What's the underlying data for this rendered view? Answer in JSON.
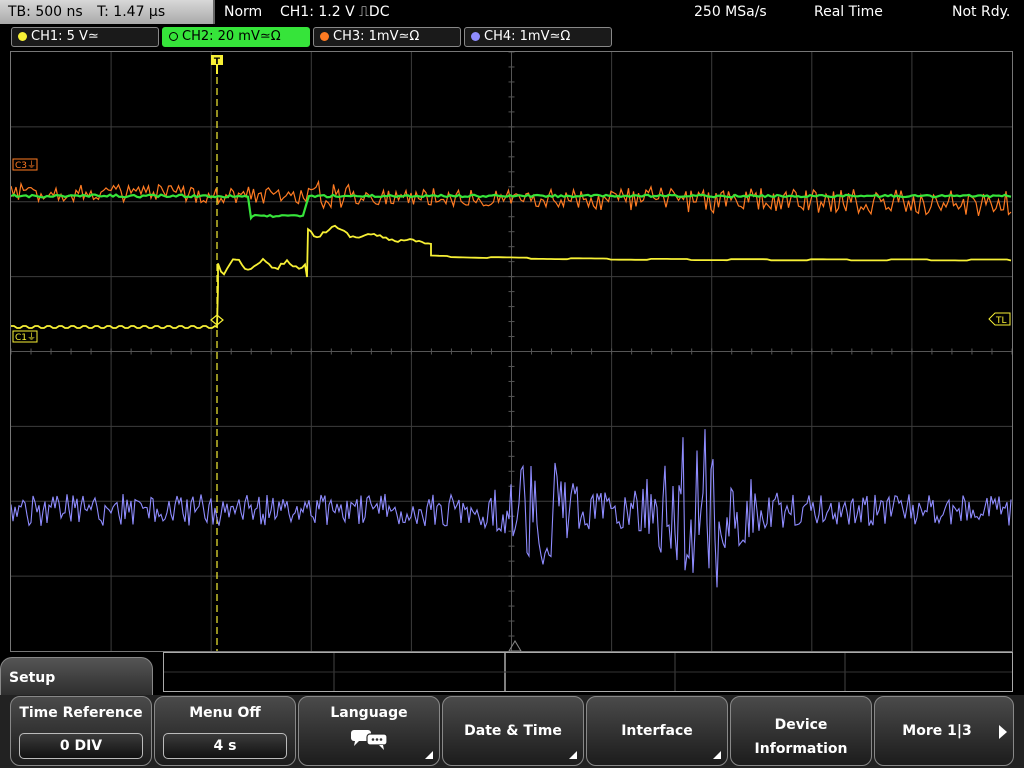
{
  "status": {
    "timebase": "TB: 500 ns",
    "trigger_time": "T: 1.47 µs",
    "mode": "Norm",
    "trigger": "CH1: 1.2 V ⎍DC",
    "sample_rate": "250 MSa/s",
    "acq": "Real Time",
    "state": "Not Rdy."
  },
  "channels": [
    {
      "label": "CH1: 5 V≃",
      "color": "#f7f035"
    },
    {
      "label": "CH2: 20 mV≃Ω",
      "color": "#36e43a"
    },
    {
      "label": "CH3: 1mV≃Ω",
      "color": "#ff7b22"
    },
    {
      "label": "CH4: 1mV≃Ω",
      "color": "#8f8cff"
    }
  ],
  "markers": {
    "c3": "C3⏚",
    "c1": "C1⏚",
    "tl": "TL",
    "trigger": "T"
  },
  "menu": {
    "title": "Setup",
    "time_reference": {
      "title": "Time Reference",
      "value": "0 DIV"
    },
    "menu_off": {
      "title": "Menu Off",
      "value": "4 s"
    },
    "language": {
      "title": "Language"
    },
    "date_time": "Date & Time",
    "interface": "Interface",
    "device_info_1": "Device",
    "device_info_2": "Information",
    "more": "More 1|3"
  },
  "colors": {
    "grid": "#3d3d3d",
    "ch1": "#f7f035",
    "ch2": "#36e43a",
    "ch3": "#ff7b22",
    "ch4": "#8f8cff"
  }
}
